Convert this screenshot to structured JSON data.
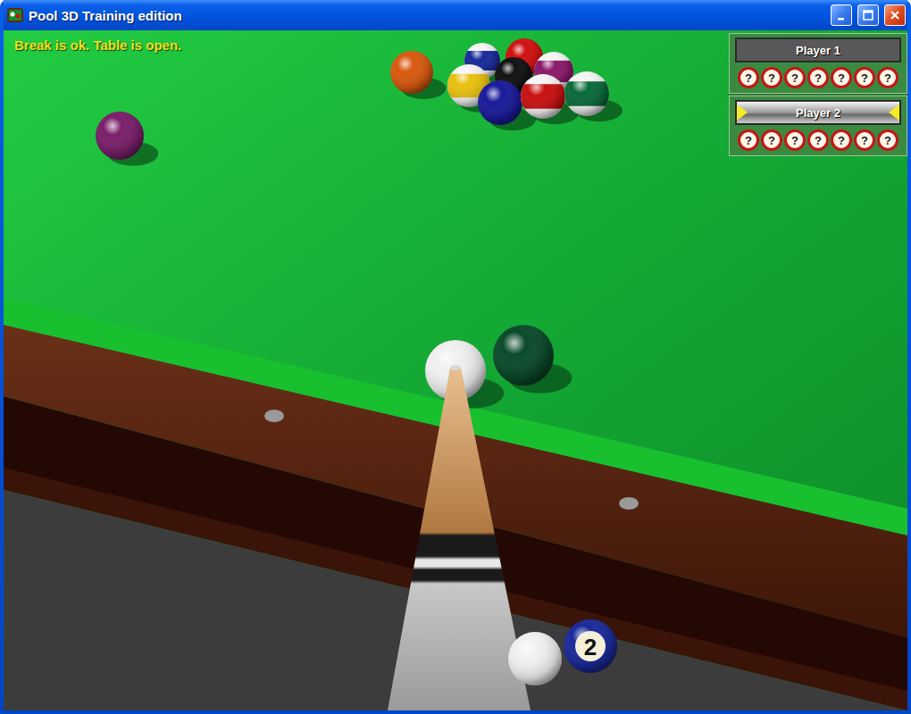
{
  "window": {
    "title": "Pool 3D Training edition"
  },
  "status_message": "Break is ok. Table is open.",
  "players": [
    {
      "name": "Player 1",
      "selected": false,
      "balls": [
        "?",
        "?",
        "?",
        "?",
        "?",
        "?",
        "?"
      ]
    },
    {
      "name": "Player 2",
      "selected": true,
      "balls": [
        "?",
        "?",
        "?",
        "?",
        "?",
        "?",
        "?"
      ]
    }
  ],
  "table_balls": [
    {
      "kind": "solid",
      "color": "#d85a10"
    },
    {
      "kind": "stripe",
      "color": "#1a2a9a"
    },
    {
      "kind": "solid",
      "color": "#d01010"
    },
    {
      "kind": "stripe",
      "color": "#e8c010"
    },
    {
      "kind": "solid",
      "color": "#111111"
    },
    {
      "kind": "stripe",
      "color": "#8a1a6a"
    },
    {
      "kind": "solid",
      "color": "#1a1a9a"
    },
    {
      "kind": "stripe",
      "color": "#c81010"
    },
    {
      "kind": "stripe",
      "color": "#0a6a3a"
    },
    {
      "kind": "solid",
      "color": "#7a1f6a"
    },
    {
      "kind": "solid",
      "color": "#0a4a2a"
    },
    {
      "kind": "cue",
      "color": "#f0f0f0"
    }
  ],
  "ball_in_hand": {
    "number": "2",
    "color": "#1a2a9a"
  }
}
